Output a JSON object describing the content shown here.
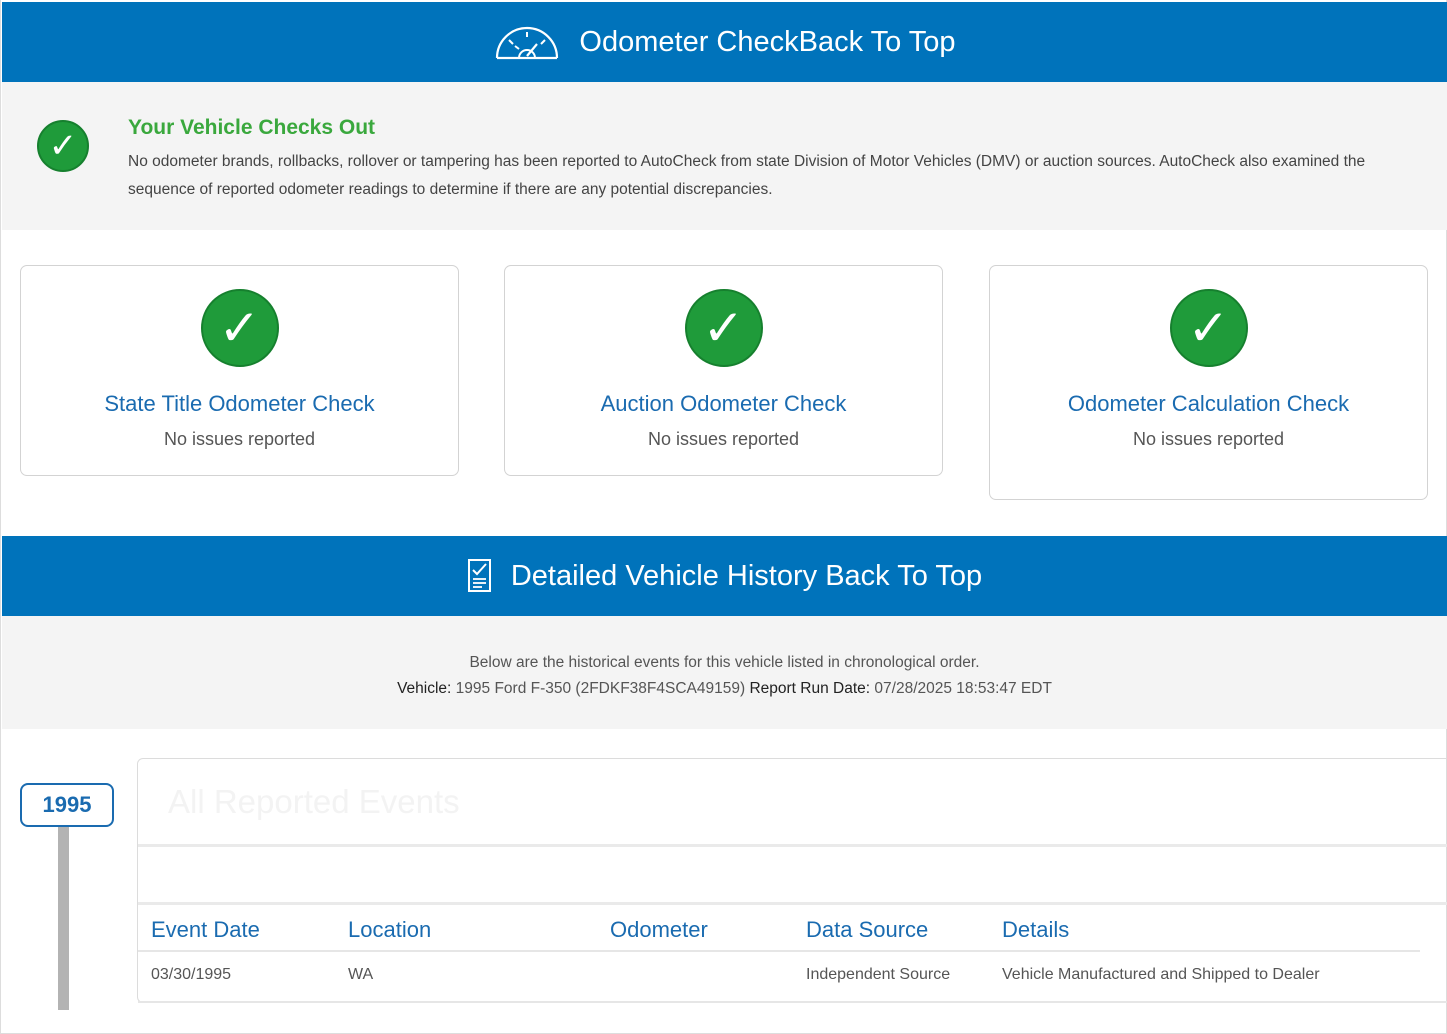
{
  "odometer_banner": {
    "title": "Odometer Check",
    "back_link": "Back To Top",
    "icon": "speedometer-icon"
  },
  "checks_out": {
    "icon": "check-icon",
    "title": "Your Vehicle Checks Out",
    "text": "No odometer brands, rollbacks, rollover or tampering has been reported to AutoCheck from state Division of Motor Vehicles (DMV) or auction sources. AutoCheck also examined the sequence of reported odometer readings to determine if there are any potential discrepancies."
  },
  "cards": [
    {
      "title": "State Title Odometer Check",
      "status": "No issues reported"
    },
    {
      "title": "Auction Odometer Check",
      "status": "No issues reported"
    },
    {
      "title": "Odometer Calculation Check",
      "status": "No issues reported"
    }
  ],
  "history_banner": {
    "title": "Detailed Vehicle History",
    "back_link": "Back To Top",
    "icon": "document-check-icon"
  },
  "history_intro": {
    "line1": "Below are the historical events for this vehicle listed in chronological order.",
    "vehicle_label": "Vehicle:",
    "vehicle_value": "1995 Ford F-350 (2FDKF38F4SCA49159)",
    "run_date_label": "Report Run Date:",
    "run_date_value": "07/28/2025 18:53:47 EDT"
  },
  "timeline": {
    "year": "1995"
  },
  "events": {
    "title": "All Reported Events",
    "columns": [
      "Event Date",
      "Location",
      "Odometer",
      "Data Source",
      "Details"
    ],
    "rows": [
      {
        "date": "03/30/1995",
        "location": "WA",
        "odometer": "",
        "source": "Independent Source",
        "details": "Vehicle Manufactured and Shipped to Dealer"
      }
    ]
  },
  "colors": {
    "brand_blue": "#0073bb",
    "success_green": "#1f9b3a",
    "link_blue": "#1a6bb0"
  }
}
